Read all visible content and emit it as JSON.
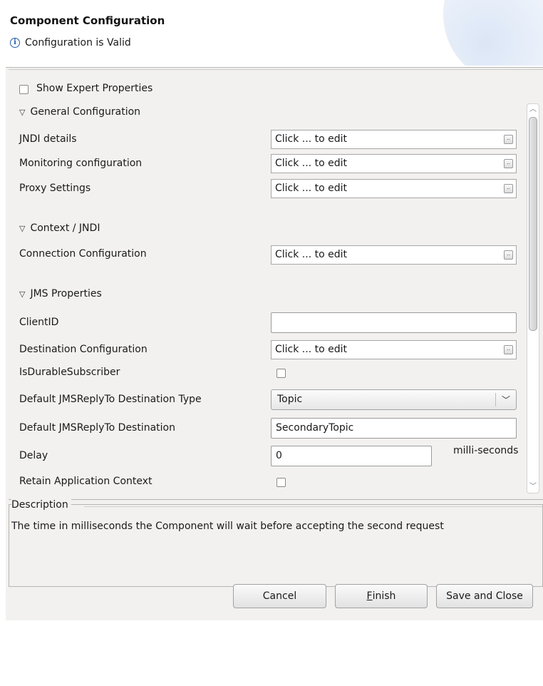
{
  "header": {
    "title": "Component Configuration",
    "status_message": "Configuration is Valid",
    "status_icon": "info-icon"
  },
  "options": {
    "show_expert_label": "Show Expert Properties",
    "show_expert_checked": false
  },
  "sections": {
    "general": "General Configuration",
    "context": "Context / JNDI",
    "jms": "JMS Properties"
  },
  "fields": {
    "jndi_details": {
      "label": "JNDI details",
      "value": "Click ... to edit"
    },
    "monitoring": {
      "label": "Monitoring configuration",
      "value": "Click ... to edit"
    },
    "proxy": {
      "label": "Proxy Settings",
      "value": "Click ... to edit"
    },
    "connection": {
      "label": "Connection Configuration",
      "value": "Click ... to edit"
    },
    "client_id": {
      "label": "ClientID",
      "value": ""
    },
    "destination": {
      "label": "Destination Configuration",
      "value": "Click ... to edit"
    },
    "durable": {
      "label": "IsDurableSubscriber",
      "checked": false
    },
    "reply_type": {
      "label": "Default JMSReplyTo Destination Type",
      "value": "Topic"
    },
    "reply_dest": {
      "label": "Default JMSReplyTo Destination",
      "value": "SecondaryTopic"
    },
    "delay": {
      "label": "Delay",
      "value": "0",
      "unit": "milli-seconds"
    },
    "retain": {
      "label": "Retain Application Context",
      "checked": false
    }
  },
  "description": {
    "title": "Description",
    "text": "The time in milliseconds the Component will wait before accepting the second request"
  },
  "buttons": {
    "cancel": "Cancel",
    "finish_mnemonic": "F",
    "finish_rest": "inish",
    "save_close": "Save and Close"
  },
  "colors": {
    "panel_bg": "#f2f1f0",
    "info_blue": "#1f5fbf"
  }
}
